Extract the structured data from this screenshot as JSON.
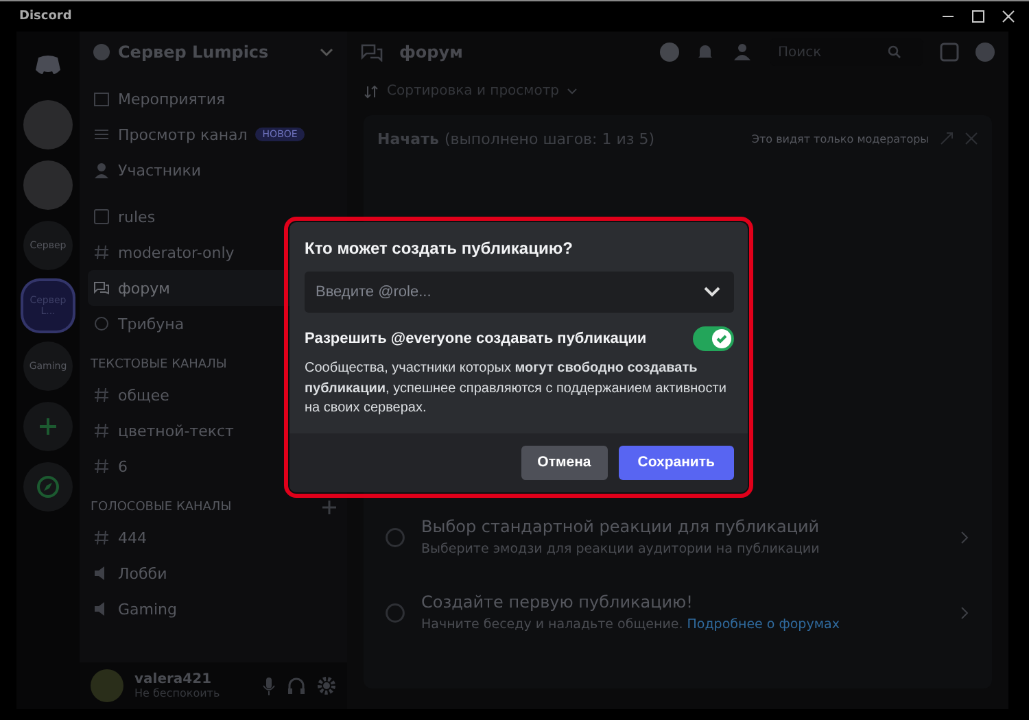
{
  "window": {
    "title": "Discord"
  },
  "servers": [
    {
      "kind": "home",
      "selected": false
    },
    {
      "kind": "avatar",
      "selected": false
    },
    {
      "kind": "avatar",
      "selected": false
    },
    {
      "label": "Сервер",
      "kind": "text",
      "selected": false
    },
    {
      "label": "Сервер L...",
      "kind": "text",
      "selected": true
    },
    {
      "label": "Gaming",
      "kind": "text",
      "selected": false
    },
    {
      "kind": "add",
      "selected": false
    },
    {
      "kind": "explore",
      "selected": false
    }
  ],
  "sidebar": {
    "server_name": "Сервер Lumpics",
    "items": [
      {
        "kind": "events",
        "label": "Мероприятия",
        "selected": false
      },
      {
        "kind": "browse",
        "label": "Просмотр канал",
        "badge": "НОВОЕ",
        "selected": false
      },
      {
        "kind": "members",
        "label": "Участники",
        "selected": false
      }
    ],
    "channels": [
      {
        "kind": "rules",
        "label": "rules",
        "selected": false
      },
      {
        "kind": "text",
        "label": "moderator-only",
        "selected": false
      },
      {
        "kind": "forum",
        "label": "форум",
        "selected": true
      },
      {
        "kind": "stage",
        "label": "Трибуна",
        "selected": false
      }
    ],
    "categories": [
      {
        "name": "ТЕКСТОВЫЕ КАНАЛЫ",
        "kind": "text",
        "channels": [
          {
            "kind": "text",
            "label": "общее"
          },
          {
            "kind": "text",
            "label": "цветной-текст"
          },
          {
            "kind": "text",
            "label": "6"
          }
        ]
      },
      {
        "name": "ГОЛОСОВЫЕ КАНАЛЫ",
        "kind": "voice",
        "channels": [
          {
            "kind": "text",
            "label": "444"
          },
          {
            "kind": "voice",
            "label": "Лобби"
          },
          {
            "kind": "voice",
            "label": "Gaming"
          }
        ]
      }
    ],
    "user": {
      "name": "valera421",
      "status": "Не беспокоить"
    }
  },
  "header": {
    "channel": "форум",
    "search_placeholder": "Поиск"
  },
  "sort_label": "Сортировка и просмотр",
  "checklist": {
    "title": "Начать",
    "progress": "(выполнено шагов: 1 из 5)",
    "note": "Это видят только модераторы",
    "steps": [
      {
        "title": "Выбор стандартной реакции для публикаций",
        "text": "Выберите эмодзи для реакции аудитории на публикации"
      },
      {
        "title": "Создайте первую публикацию!",
        "text": "Начните беседу и наладьте общение.",
        "link": "Подробнее о форумах"
      }
    ]
  },
  "modal": {
    "title": "Кто может создать публикацию?",
    "select_placeholder": "Введите @role...",
    "toggle_label": "Разрешить @everyone создавать публикации",
    "toggle_on": true,
    "description": "Сообщества, участники которых **могут свободно создавать публикации**, успешнее справляются с поддержанием активности на своих серверах.",
    "buttons": [
      {
        "label": "Отмена",
        "kind": "secondary"
      },
      {
        "label": "Сохранить",
        "kind": "primary"
      }
    ]
  }
}
